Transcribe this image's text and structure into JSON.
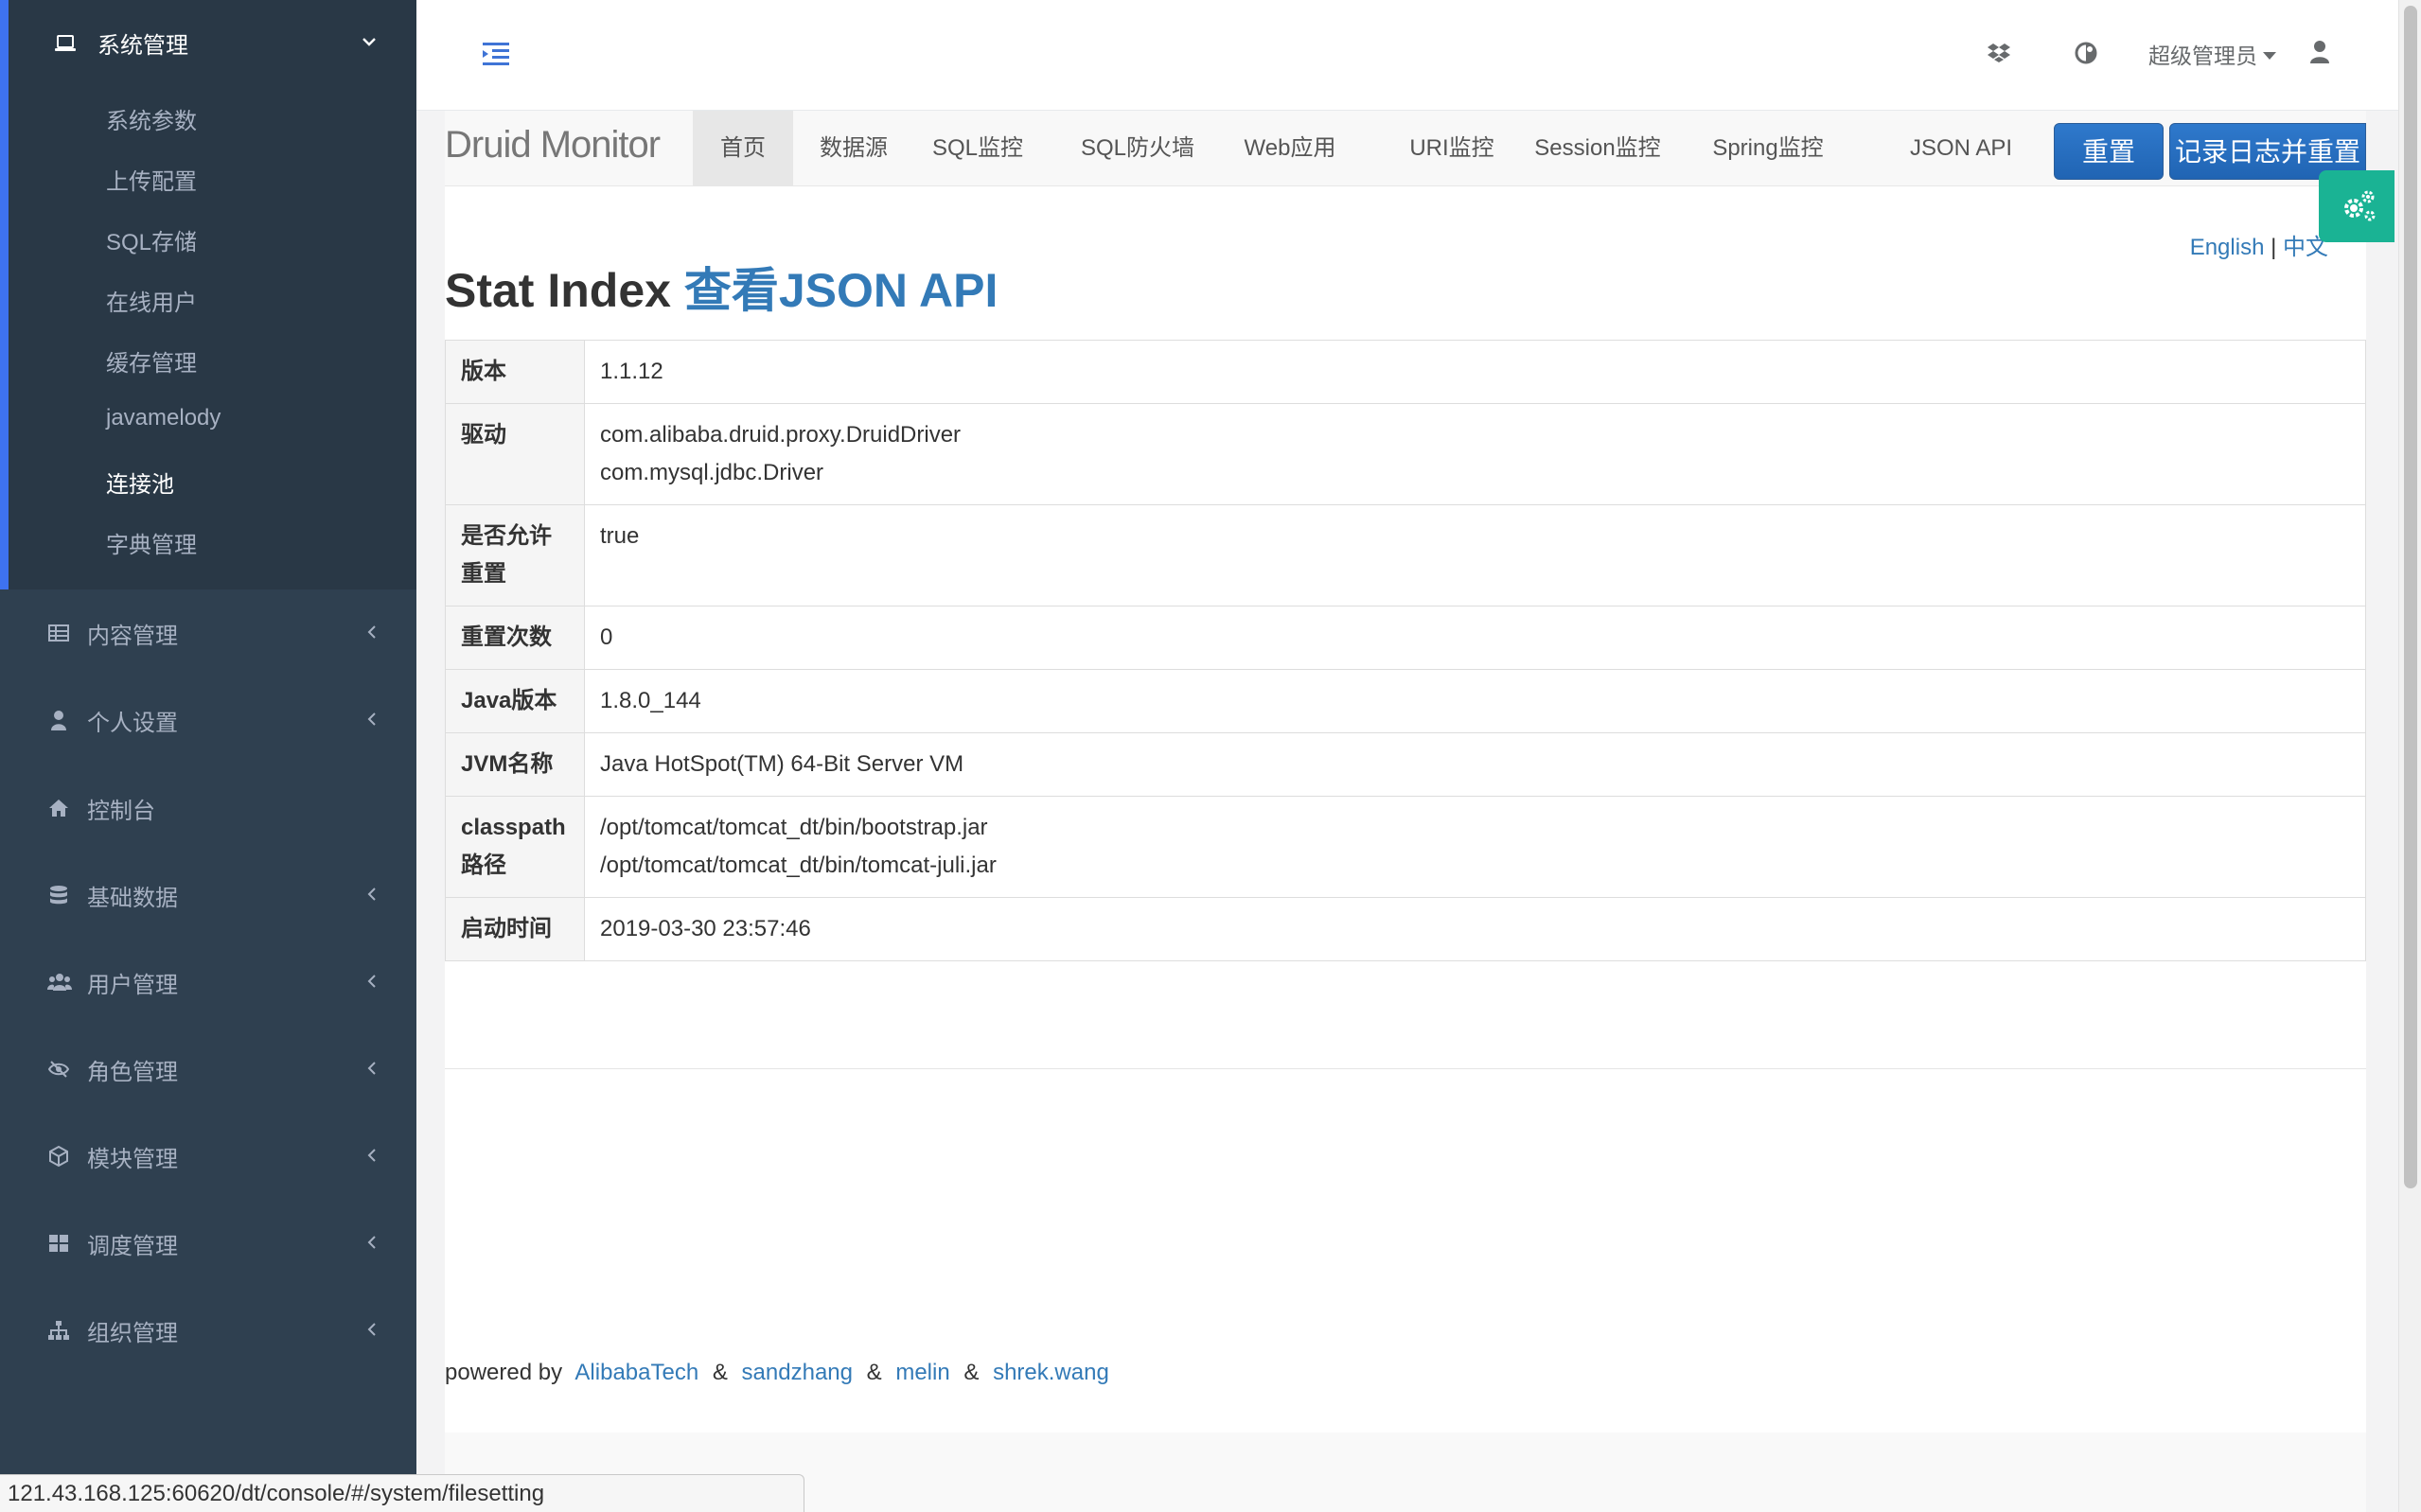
{
  "sidebar": {
    "group": {
      "label": "系统管理"
    },
    "sub_items": [
      {
        "label": "系统参数",
        "current": false
      },
      {
        "label": "上传配置",
        "current": false
      },
      {
        "label": "SQL存储",
        "current": false
      },
      {
        "label": "在线用户",
        "current": false
      },
      {
        "label": "缓存管理",
        "current": false
      },
      {
        "label": "javamelody",
        "current": false
      },
      {
        "label": "连接池",
        "current": true
      },
      {
        "label": "字典管理",
        "current": false
      }
    ],
    "items": [
      {
        "label": "内容管理",
        "icon": "table-icon",
        "has_children": true
      },
      {
        "label": "个人设置",
        "icon": "user-icon",
        "has_children": true
      },
      {
        "label": "控制台",
        "icon": "home-icon",
        "has_children": false
      },
      {
        "label": "基础数据",
        "icon": "database-icon",
        "has_children": true
      },
      {
        "label": "用户管理",
        "icon": "users-icon",
        "has_children": true
      },
      {
        "label": "角色管理",
        "icon": "eye-slash-icon",
        "has_children": true
      },
      {
        "label": "模块管理",
        "icon": "cube-icon",
        "has_children": true
      },
      {
        "label": "调度管理",
        "icon": "grid-icon",
        "has_children": true
      },
      {
        "label": "组织管理",
        "icon": "sitemap-icon",
        "has_children": true
      }
    ]
  },
  "topbar": {
    "user_label": "超级管理员"
  },
  "druid": {
    "brand": "Druid Monitor",
    "tabs": [
      "首页",
      "数据源",
      "SQL监控",
      "SQL防火墙",
      "Web应用",
      "URI监控",
      "Session监控",
      "Spring监控",
      "JSON API"
    ],
    "active_tab": "首页",
    "reset_button": "重置",
    "log_reset_button": "记录日志并重置",
    "lang_en": "English",
    "lang_sep": "|",
    "lang_zh": "中文",
    "heading": "Stat Index",
    "heading_link": "查看JSON API",
    "rows": [
      {
        "key": "版本",
        "values": [
          "1.1.12"
        ]
      },
      {
        "key": "驱动",
        "values": [
          "com.alibaba.druid.proxy.DruidDriver",
          "com.mysql.jdbc.Driver"
        ]
      },
      {
        "key": "是否允许重置",
        "values": [
          "true"
        ]
      },
      {
        "key": "重置次数",
        "values": [
          "0"
        ]
      },
      {
        "key": "Java版本",
        "values": [
          "1.8.0_144"
        ]
      },
      {
        "key": "JVM名称",
        "values": [
          "Java HotSpot(TM) 64-Bit Server VM"
        ]
      },
      {
        "key": "classpath路径",
        "values": [
          "/opt/tomcat/tomcat_dt/bin/bootstrap.jar",
          "/opt/tomcat/tomcat_dt/bin/tomcat-juli.jar"
        ]
      },
      {
        "key": "启动时间",
        "values": [
          "2019-03-30 23:57:46"
        ]
      }
    ],
    "footer": {
      "prefix": "powered by",
      "authors": [
        "AlibabaTech",
        "sandzhang",
        "melin",
        "shrek.wang"
      ],
      "sep": "&"
    }
  },
  "status_url": "121.43.168.125:60620/dt/console/#/system/filesetting",
  "colors": {
    "sidebar_bg": "#2f4050",
    "sidebar_active_bg": "#293846",
    "sidebar_accent": "#3e72f0",
    "link_blue": "#337ab7",
    "button_blue": "#2f79cc",
    "fab_green": "#1ab394"
  }
}
